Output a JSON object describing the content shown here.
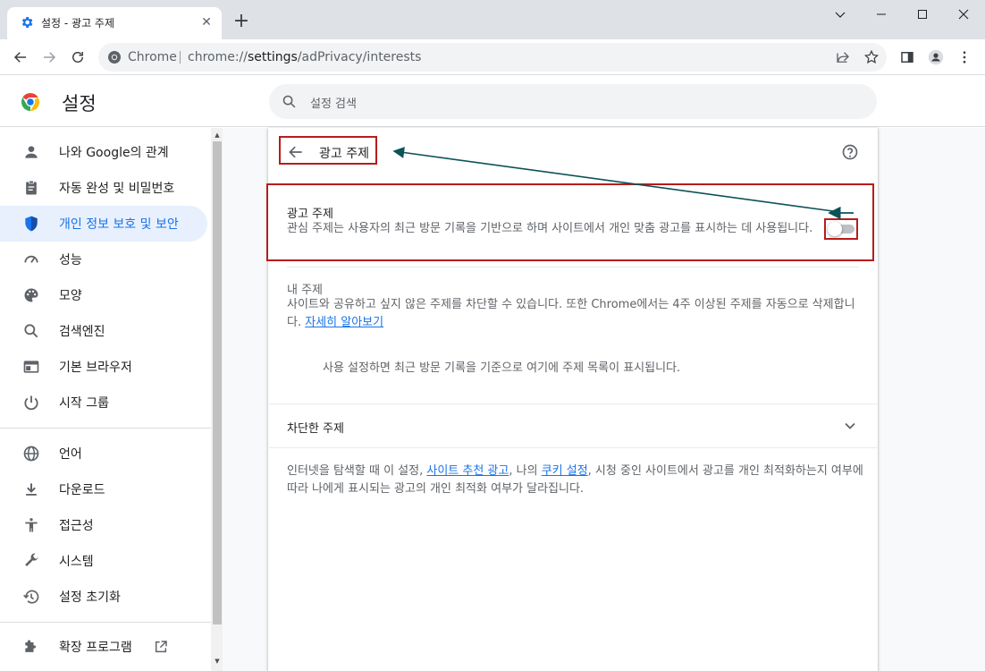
{
  "window": {
    "tab_title": "설정 - 광고 주제",
    "tab_close": "✕",
    "new_tab": "+"
  },
  "toolbar": {
    "omnibox_site": "Chrome",
    "omnibox_url_scheme": "chrome://",
    "omnibox_url_host": "settings",
    "omnibox_url_path": "/adPrivacy/interests"
  },
  "header": {
    "title": "설정",
    "search_placeholder": "설정 검색"
  },
  "sidebar": {
    "items": [
      {
        "label": "나와 Google의 관계",
        "icon": "person-icon"
      },
      {
        "label": "자동 완성 및 비밀번호",
        "icon": "clipboard-icon"
      },
      {
        "label": "개인 정보 보호 및 보안",
        "icon": "shield-icon",
        "active": true
      },
      {
        "label": "성능",
        "icon": "speedometer-icon"
      },
      {
        "label": "모양",
        "icon": "palette-icon"
      },
      {
        "label": "검색엔진",
        "icon": "search-icon"
      },
      {
        "label": "기본 브라우저",
        "icon": "browser-icon"
      },
      {
        "label": "시작 그룹",
        "icon": "power-icon"
      },
      {
        "label": "언어",
        "icon": "globe-icon"
      },
      {
        "label": "다운로드",
        "icon": "download-icon"
      },
      {
        "label": "접근성",
        "icon": "accessibility-icon"
      },
      {
        "label": "시스템",
        "icon": "wrench-icon"
      },
      {
        "label": "설정 초기화",
        "icon": "history-icon"
      },
      {
        "label": "확장 프로그램",
        "icon": "puzzle-icon"
      }
    ]
  },
  "main": {
    "page_title": "광고 주제",
    "ad_topics": {
      "title": "광고 주제",
      "description": "관심 주제는 사용자의 최근 방문 기록을 기반으로 하며 사이트에서 개인 맞춤 광고를 표시하는 데 사용됩니다.",
      "enabled": false
    },
    "my_topics": {
      "label": "내 주제",
      "description": "사이트와 공유하고 싶지 않은 주제를 차단할 수 있습니다. 또한 Chrome에서는 4주 이상된 주제를 자동으로 삭제합니다.",
      "learn_more": "자세히 알아보기",
      "empty_message": "사용 설정하면 최근 방문 기록을 기준으로 여기에 주제 목록이 표시됩니다."
    },
    "blocked_topics": {
      "title": "차단한 주제"
    },
    "footer": {
      "part1": "인터넷을 탐색할 때 이 설정, ",
      "link1": "사이트 추천 광고",
      "part2": ", 나의 ",
      "link2": "쿠키 설정",
      "part3": ", 시청 중인 사이트에서 광고를 개인 최적화하는지 여부에 따라 나에게 표시되는 광고의 개인 최적화 여부가 달라집니다."
    }
  },
  "colors": {
    "accent": "#1a73e8",
    "annotation": "#b71c1c",
    "arrow": "#0d5257"
  }
}
